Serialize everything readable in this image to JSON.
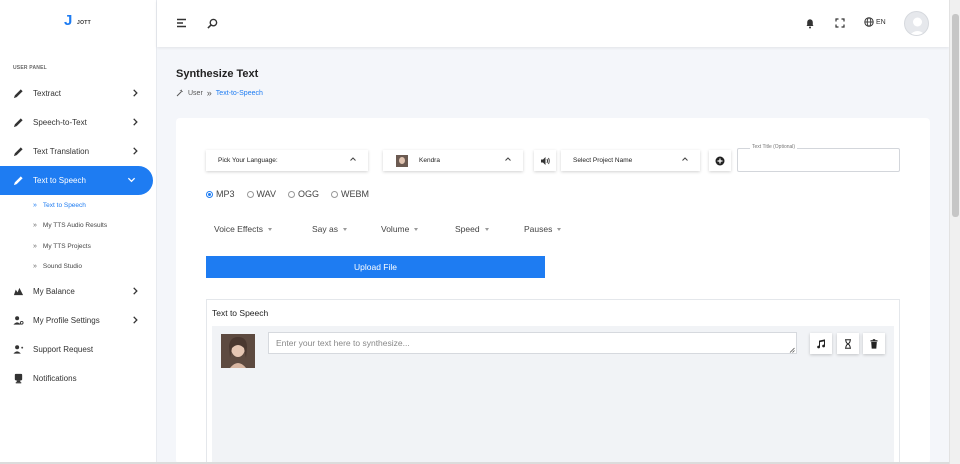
{
  "app": {
    "logo_letter": "J",
    "logo_text": "JOTT"
  },
  "sidebar": {
    "panel_label": "USER PANEL",
    "items": [
      {
        "label": "Textract",
        "icon": "pen-icon",
        "has_chevron": true
      },
      {
        "label": "Speech-to-Text",
        "icon": "pen-icon",
        "has_chevron": true
      },
      {
        "label": "Text Translation",
        "icon": "pen-icon",
        "has_chevron": true
      },
      {
        "label": "Text to Speech",
        "icon": "pen-icon",
        "has_chevron": true,
        "active": true,
        "expanded": true
      },
      {
        "label": "My Balance",
        "icon": "balance-icon",
        "has_chevron": true
      },
      {
        "label": "My Profile Settings",
        "icon": "user-settings-icon",
        "has_chevron": true
      },
      {
        "label": "Support Request",
        "icon": "support-icon",
        "has_chevron": false
      },
      {
        "label": "Notifications",
        "icon": "notification-icon",
        "has_chevron": false
      }
    ],
    "submenu": [
      {
        "label": "Text to Speech",
        "active": true
      },
      {
        "label": "My TTS Audio Results"
      },
      {
        "label": "My TTS Projects"
      },
      {
        "label": "Sound Studio"
      }
    ]
  },
  "topbar": {
    "language": "EN"
  },
  "page": {
    "title": "Synthesize Text",
    "breadcrumb": {
      "root": "User",
      "current": "Text-to-Speech"
    }
  },
  "controls": {
    "language_select": "Pick Your Language:",
    "voice_select": "Kendra",
    "project_select": "Select Project Name",
    "text_title_legend": "Text Title (Optional)",
    "text_title_value": ""
  },
  "formats": [
    {
      "label": "MP3",
      "checked": true
    },
    {
      "label": "WAV",
      "checked": false
    },
    {
      "label": "OGG",
      "checked": false
    },
    {
      "label": "WEBM",
      "checked": false
    }
  ],
  "effects": [
    "Voice Effects",
    "Say as",
    "Volume",
    "Speed",
    "Pauses"
  ],
  "upload_label": "Upload File",
  "tts": {
    "section_label": "Text to Speech",
    "input_placeholder": "Enter your text here to synthesize...",
    "input_value": ""
  },
  "colors": {
    "accent": "#1e7cf2",
    "background": "#f4f6fa",
    "card": "#ffffff"
  }
}
